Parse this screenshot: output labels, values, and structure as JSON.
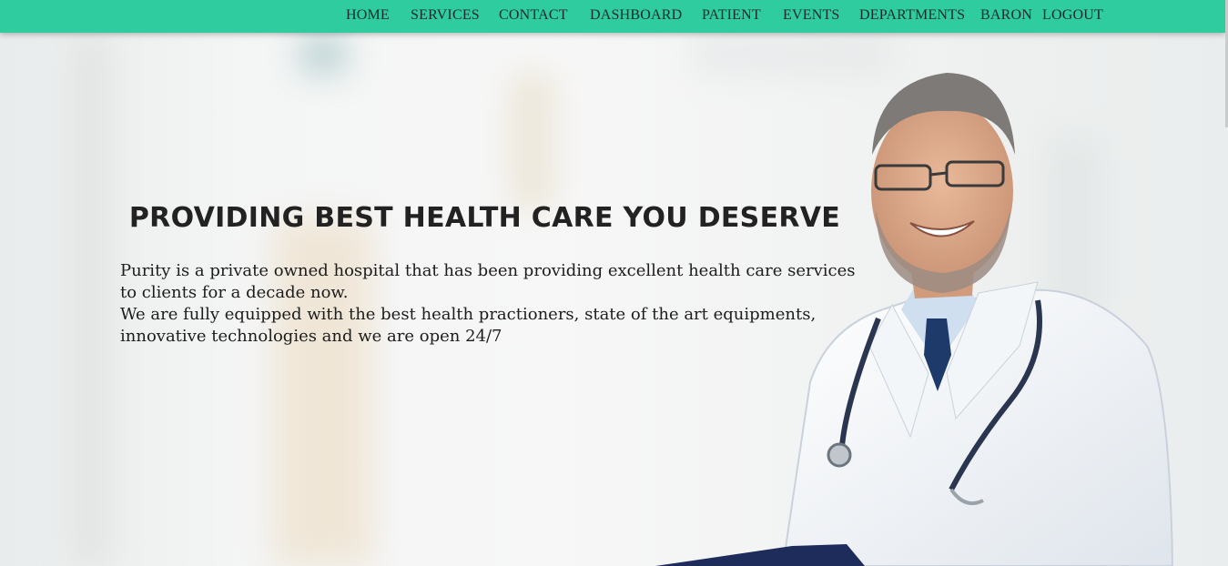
{
  "nav": {
    "items": [
      "HOME",
      "SERVICES",
      "CONTACT",
      "DASHBOARD",
      "PATIENT",
      "EVENTS",
      "DEPARTMENTS"
    ],
    "user": "BARON",
    "logout": "LOGOUT"
  },
  "hero": {
    "headline": "PROVIDING BEST HEALTH CARE YOU DESERVE",
    "paragraph1": "Purity is a private owned hospital that has been providing excellent health care services to clients for a decade now.",
    "paragraph2": "We are fully equipped with the best health practioners, state of the art equipments, innovative technologies and we are open 24/7"
  },
  "colors": {
    "navbar": "#2ecc9f",
    "text": "#222222"
  }
}
